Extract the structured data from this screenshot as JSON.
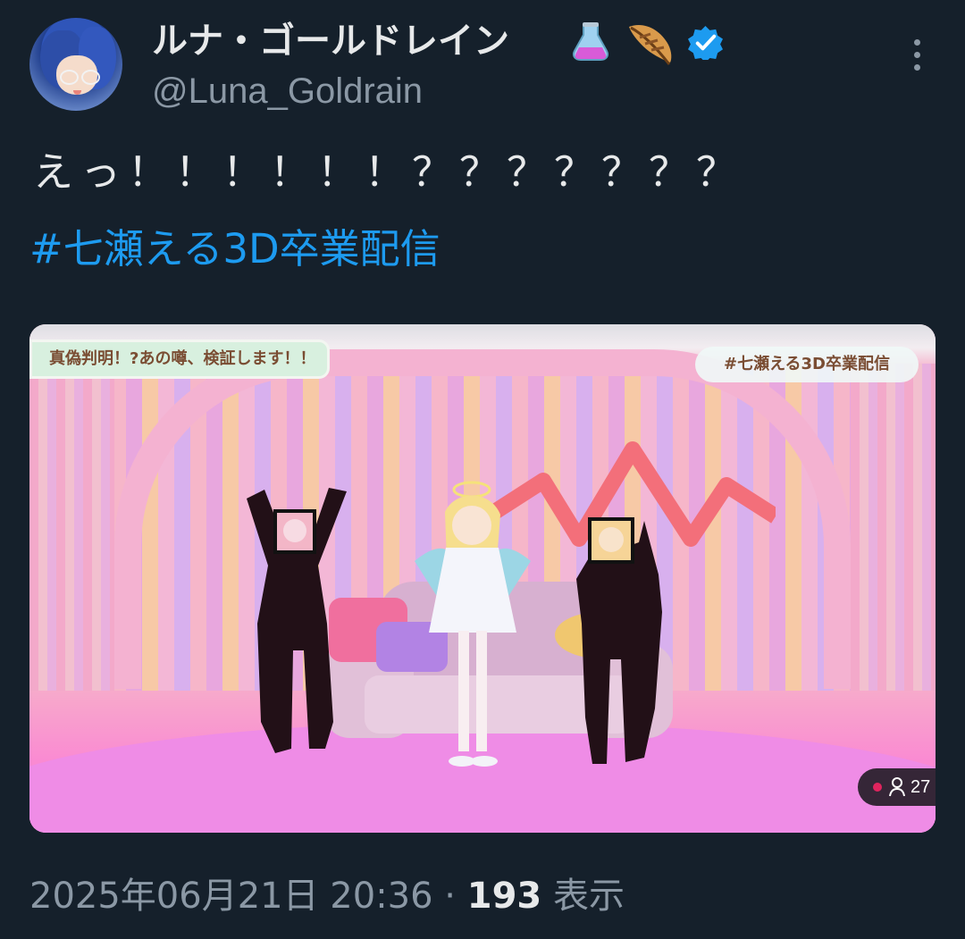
{
  "author": {
    "display_name": "ルナ・ゴールドレイン",
    "emoji": [
      "alembic-flask-emoji",
      "feather-emoji"
    ],
    "verified": true,
    "handle": "@Luna_Goldrain"
  },
  "tweet": {
    "text": "えっ！！！！！！？？？？？？？",
    "hashtag": "#七瀬える3D卒業配信"
  },
  "media": {
    "banner_left": "真偽判明！?あの噂、検証します！！",
    "banner_right": "#七瀬える3D卒業配信",
    "viewer_count": "27",
    "icons": [
      "live-dot-icon",
      "person-icon"
    ]
  },
  "meta": {
    "timestamp": "2025年06月21日 20:36 · ",
    "views": "193",
    "views_label": " 表示"
  },
  "colors": {
    "background": "#15202b",
    "text": "#e7e9ea",
    "secondary": "#8b98a5",
    "link": "#1d9bf0"
  }
}
